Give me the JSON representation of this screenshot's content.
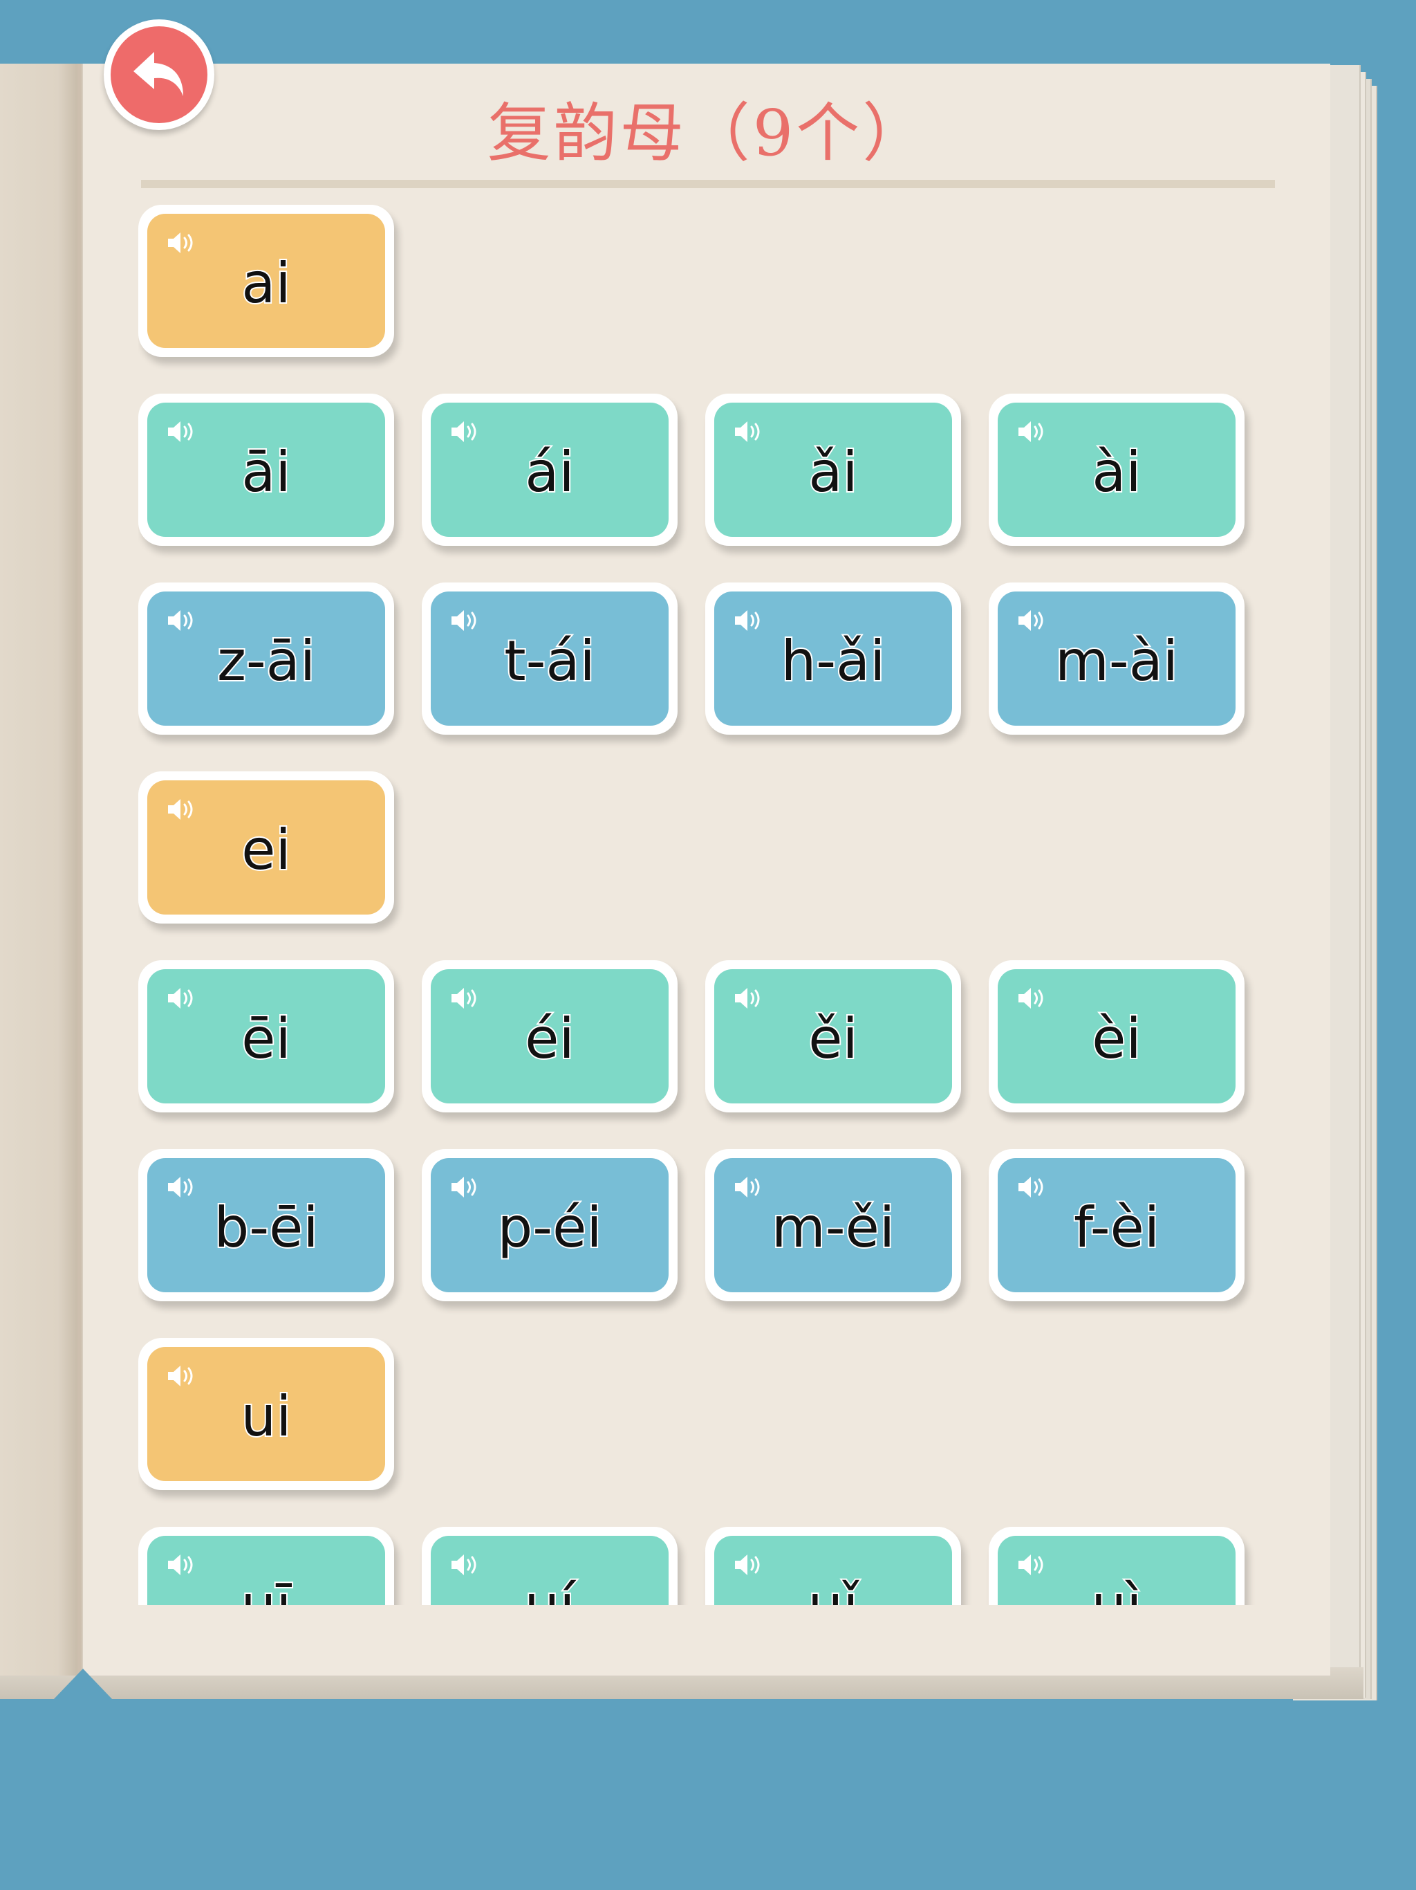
{
  "header": {
    "title": "复韵母（9个）",
    "back_icon": "back-arrow-icon"
  },
  "colors": {
    "background": "#5ea1bf",
    "page": "#efe8de",
    "accent": "#ee6b6a",
    "vowel_card": "#f4c574",
    "tone_card": "#7ed9c7",
    "syllable_card": "#78bed6"
  },
  "groups": [
    {
      "final": "ai",
      "tones": [
        "āi",
        "ái",
        "ǎi",
        "ài"
      ],
      "syllables": [
        "z-āi",
        "t-ái",
        "h-ǎi",
        "m-ài"
      ]
    },
    {
      "final": "ei",
      "tones": [
        "ēi",
        "éi",
        "ěi",
        "èi"
      ],
      "syllables": [
        "b-ēi",
        "p-éi",
        "m-ěi",
        "f-èi"
      ]
    },
    {
      "final": "ui",
      "tones": [
        "uī",
        "uí",
        "uǐ",
        "uì"
      ],
      "syllables": []
    }
  ]
}
